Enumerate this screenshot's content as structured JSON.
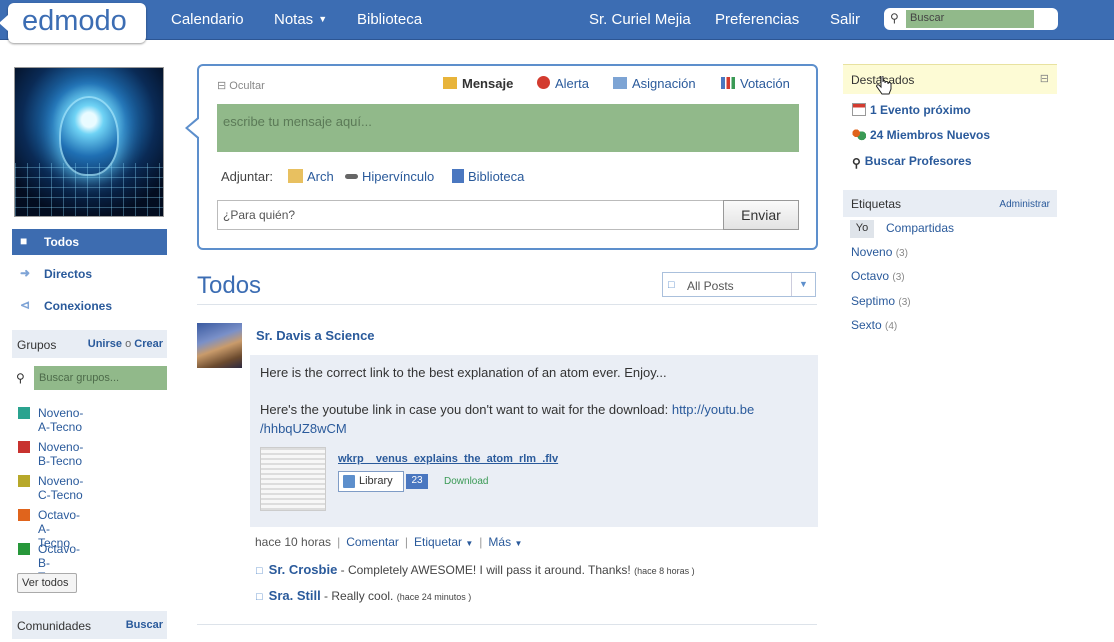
{
  "topbar": {
    "logo": "edmodo",
    "nav": [
      "Calendario",
      "Notas",
      "Biblioteca"
    ],
    "user": "Sr. Curiel Mejia",
    "preferences": "Preferencias",
    "logout": "Salir",
    "search_placeholder": "Buscar"
  },
  "left": {
    "nav": [
      "Todos",
      "Directos",
      "Conexiones"
    ],
    "groups_header": "Grupos",
    "groups_join": "Unirse",
    "groups_or": "o",
    "groups_create": "Crear",
    "groups_search_placeholder": "Buscar grupos...",
    "groups": [
      {
        "label": "Noveno-A-Tecno",
        "color": "#2aa38f"
      },
      {
        "label": "Noveno-B-Tecno",
        "color": "#c8322f"
      },
      {
        "label": "Noveno-C-Tecno",
        "color": "#b7a82a"
      },
      {
        "label": "Octavo-A-Tecno",
        "color": "#e0641c"
      },
      {
        "label": "Octavo-B-Tecno",
        "color": "#27973a"
      }
    ],
    "see_all": "Ver todos",
    "communities_header": "Comunidades",
    "communities_search": "Buscar"
  },
  "composer": {
    "hide": "Ocultar",
    "tabs": [
      "Mensaje",
      "Alerta",
      "Asignación",
      "Votación"
    ],
    "message_placeholder": "escribe tu mensaje aquí...",
    "attach_label": "Adjuntar:",
    "attach_file": "Arch",
    "attach_link": "Hipervínculo",
    "attach_library": "Biblioteca",
    "recipient_placeholder": "¿Para quién?",
    "send": "Enviar"
  },
  "feed": {
    "title": "Todos",
    "filter": "All Posts",
    "post": {
      "author": "Sr. Davis a Science",
      "line1": "Here is the correct link to the best explanation of an atom ever. Enjoy...",
      "line2_text": "Here's the youtube link in case you don't want to wait for the download:",
      "line2_link": "http://youtu.be",
      "line3_link": "/hhbqUZ8wCM",
      "file_name": "wkrp__venus_explains_the_atom_rlm_.flv",
      "library_btn": "Library",
      "library_count": "23",
      "download": "Download",
      "time": "hace 10 horas",
      "comment_action": "Comentar",
      "tag_action": "Etiquetar",
      "more_action": "Más"
    },
    "comments": [
      {
        "author": "Sr. Crosbie",
        "text": " - Completely AWESOME! I will pass it around. Thanks!",
        "ago": "(hace 8 horas )"
      },
      {
        "author": "Sra. Still",
        "text": " - Really cool.",
        "ago": "(hace 24 minutos )"
      }
    ]
  },
  "right": {
    "highlights_header": "Destacados",
    "highlights": [
      "1 Evento próximo",
      "24 Miembros Nuevos",
      "Buscar Profesores"
    ],
    "tags_header": "Etiquetas",
    "tags_admin": "Administrar",
    "tags_yo": "Yo",
    "tags_shared": "Compartidas",
    "tags": [
      {
        "label": "Noveno",
        "count": "(3)"
      },
      {
        "label": "Octavo",
        "count": "(3)"
      },
      {
        "label": "Septimo",
        "count": "(3)"
      },
      {
        "label": "Sexto",
        "count": "(4)"
      }
    ]
  }
}
